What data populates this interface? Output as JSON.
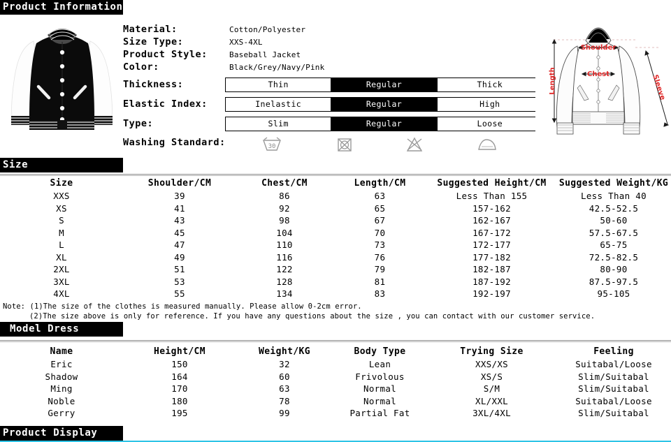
{
  "sections": {
    "product_information": "Product Information",
    "size": "Size",
    "model_dress": "Model Dress",
    "product_display": "Product Display"
  },
  "colors": {
    "header_bar": "#000000",
    "header_text": "#ffffff",
    "accent_rule": "#2ec4e6",
    "diagram_label": "#e02828",
    "selected_option_bg": "#000000"
  },
  "specs": {
    "material": {
      "label": "Material:",
      "value": "Cotton/Polyester"
    },
    "size_type": {
      "label": "Size Type:",
      "value": "XXS-4XL"
    },
    "product_style": {
      "label": "Product Style:",
      "value": "Baseball Jacket"
    },
    "color": {
      "label": "Color:",
      "value": "Black/Grey/Navy/Pink"
    },
    "thickness": {
      "label": "Thickness:",
      "options": [
        "Thin",
        "Regular",
        "Thick"
      ],
      "selected": "Regular"
    },
    "elastic_index": {
      "label": "Elastic Index:",
      "options": [
        "Inelastic",
        "Regular",
        "High"
      ],
      "selected": "Regular"
    },
    "type": {
      "label": "Type:",
      "options": [
        "Slim",
        "Regular",
        "Loose"
      ],
      "selected": "Regular"
    },
    "washing_standard": {
      "label": "Washing Standard:",
      "icons": [
        {
          "name": "wash-30-degrees-icon",
          "text": "30"
        },
        {
          "name": "do-not-tumble-dry-icon",
          "text": ""
        },
        {
          "name": "do-not-bleach-icon",
          "text": ""
        },
        {
          "name": "iron-icon",
          "text": ""
        }
      ]
    }
  },
  "diagram": {
    "labels": {
      "shoulder": "Shoulder",
      "chest": "Chest",
      "length": "Length",
      "sleeve": "Sleeve"
    }
  },
  "size_table": {
    "headers": [
      "Size",
      "Shoulder/CM",
      "Chest/CM",
      "Length/CM",
      "Suggested Height/CM",
      "Suggested Weight/KG"
    ],
    "rows": [
      [
        "XXS",
        "39",
        "86",
        "63",
        "Less Than 155",
        "Less Than 40"
      ],
      [
        "XS",
        "41",
        "92",
        "65",
        "157-162",
        "42.5-52.5"
      ],
      [
        "S",
        "43",
        "98",
        "67",
        "162-167",
        "50-60"
      ],
      [
        "M",
        "45",
        "104",
        "70",
        "167-172",
        "57.5-67.5"
      ],
      [
        "L",
        "47",
        "110",
        "73",
        "172-177",
        "65-75"
      ],
      [
        "XL",
        "49",
        "116",
        "76",
        "177-182",
        "72.5-82.5"
      ],
      [
        "2XL",
        "51",
        "122",
        "79",
        "182-187",
        "80-90"
      ],
      [
        "3XL",
        "53",
        "128",
        "81",
        "187-192",
        "87.5-97.5"
      ],
      [
        "4XL",
        "55",
        "134",
        "83",
        "192-197",
        "95-105"
      ]
    ]
  },
  "size_note": {
    "line1": "Note: (1)The size of the clothes is measured manually. Please allow 0-2cm error.",
    "line2": "(2)The size above is only for reference. If you have any questions about the size , you can contact with our customer service."
  },
  "model_table": {
    "headers": [
      "Name",
      "Height/CM",
      "Weight/KG",
      "Body Type",
      "Trying Size",
      "Feeling"
    ],
    "rows": [
      [
        "Eric",
        "150",
        "32",
        "Lean",
        "XXS/XS",
        "Suitabal/Loose"
      ],
      [
        "Shadow",
        "164",
        "60",
        "Frivolous",
        "XS/S",
        "Slim/Suitabal"
      ],
      [
        "Ming",
        "170",
        "63",
        "Normal",
        "S/M",
        "Slim/Suitabal"
      ],
      [
        "Noble",
        "180",
        "78",
        "Normal",
        "XL/XXL",
        "Suitabal/Loose"
      ],
      [
        "Gerry",
        "195",
        "99",
        "Partial Fat",
        "3XL/4XL",
        "Slim/Suitabal"
      ]
    ]
  }
}
